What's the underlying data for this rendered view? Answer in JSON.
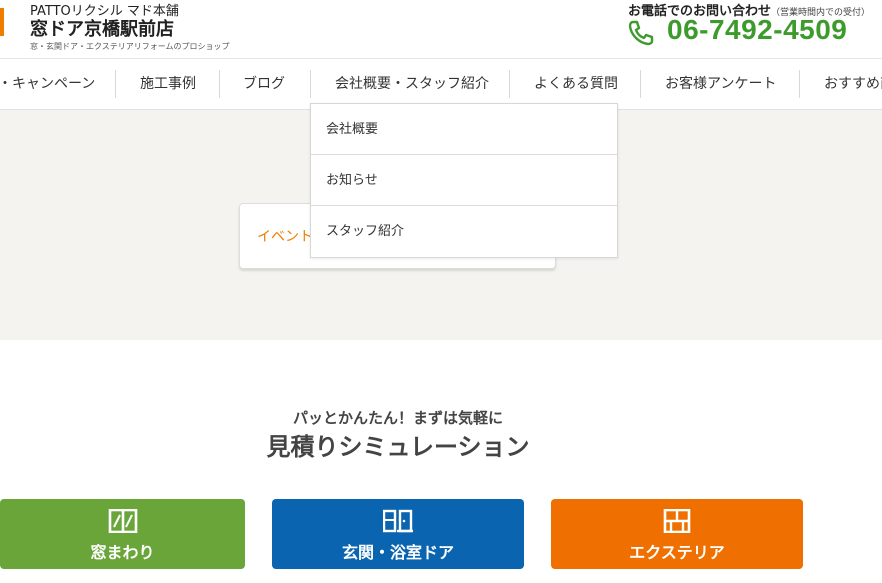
{
  "header": {
    "brand_sub": "PATTOリクシル マド本舗",
    "brand_name": "窓ドア京橋駅前店",
    "brand_tag": "窓・玄関ドア・エクステリアリフォームのプロショップ",
    "tel_label": "お電話でのお問い合わせ",
    "tel_note": "（営業時間内での受付）",
    "tel_number": "06-7492-4509",
    "tel_icon": "phone-icon",
    "accent": "#ef7d00",
    "tel_color": "#3d9b2d"
  },
  "nav": {
    "items": [
      {
        "label": "・キャンペーン"
      },
      {
        "label": "施工事例"
      },
      {
        "label": "ブログ"
      },
      {
        "label": "会社概要・スタッフ紹介"
      },
      {
        "label": "よくある質問"
      },
      {
        "label": "お客様アンケート"
      },
      {
        "label": "おすすめ商"
      }
    ]
  },
  "dropdown": {
    "items": [
      {
        "label": "会社概要"
      },
      {
        "label": "お知らせ"
      },
      {
        "label": "スタッフ紹介"
      }
    ]
  },
  "hero": {
    "tab_label": "イベント"
  },
  "simulation": {
    "subtitle": "パッとかんたん！まずは気軽に",
    "title": "見積りシミュレーション",
    "buttons": [
      {
        "label": "窓まわり",
        "icon": "window-icon",
        "color": "#6aa53a"
      },
      {
        "label": "玄関・浴室ドア",
        "icon": "door-icon",
        "color": "#0b64b0"
      },
      {
        "label": "エクステリア",
        "icon": "exterior-icon",
        "color": "#ef7000"
      }
    ]
  }
}
